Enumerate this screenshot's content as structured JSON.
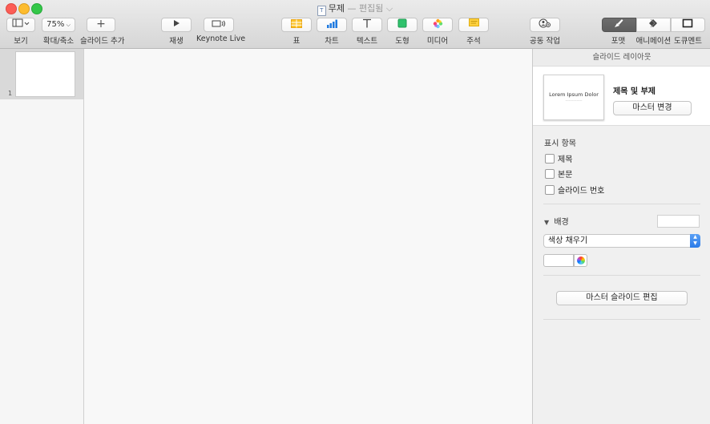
{
  "window": {
    "title": "무제",
    "separator": "—",
    "state": "편집됨"
  },
  "toolbar": {
    "view_label": "보기",
    "zoom_value": "75%",
    "zoom_label": "확대/축소",
    "add_slide_label": "슬라이드 추가",
    "play_label": "재생",
    "keynote_live_label": "Keynote Live",
    "table_label": "표",
    "chart_label": "차트",
    "text_label": "텍스트",
    "shape_label": "도형",
    "media_label": "미디어",
    "comment_label": "주석",
    "collaborate_label": "공동 작업",
    "format_label": "포맷",
    "animate_label": "애니메이션",
    "document_label": "도큐멘트"
  },
  "navigator": {
    "slides": [
      {
        "number": "1"
      }
    ]
  },
  "inspector": {
    "header": "슬라이드 레이아웃",
    "layout_name": "제목 및 부제",
    "thumb_title": "Lorem Ipsum Dolor",
    "change_master_label": "마스터 변경",
    "appearance_title": "표시 항목",
    "checkboxes": [
      {
        "label": "제목"
      },
      {
        "label": "본문"
      },
      {
        "label": "슬라이드 번호"
      }
    ],
    "background_title": "배경",
    "fill_type": "색상 채우기",
    "edit_master_label": "마스터 슬라이드 편집"
  },
  "colors": {
    "close": "#fc5d56",
    "minimize": "#fdbc2e",
    "maximize": "#33c748",
    "select_accent": "#2a7ae8"
  }
}
